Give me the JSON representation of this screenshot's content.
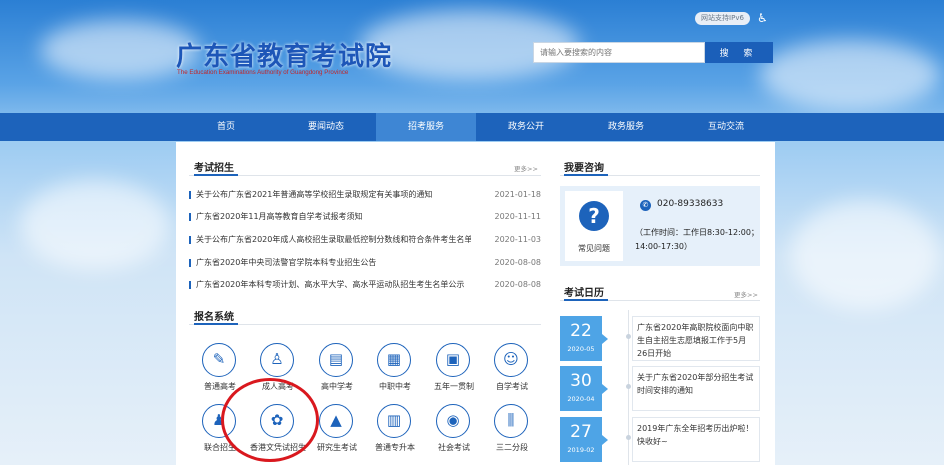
{
  "header": {
    "title": "广东省教育考试院",
    "subtitle": "The Education Examinations Authority of Guangdong Province",
    "ipv6_badge": "网站支持IPv6",
    "accessibility_icon": "accessibility-icon",
    "search": {
      "placeholder": "请输入要搜索的内容",
      "button_label": "搜 索"
    }
  },
  "nav": {
    "items": [
      {
        "label": "首页"
      },
      {
        "label": "要闻动态"
      },
      {
        "label": "招考服务"
      },
      {
        "label": "政务公开"
      },
      {
        "label": "政务服务"
      },
      {
        "label": "互动交流"
      }
    ],
    "active_index": 2
  },
  "exam_recruit": {
    "title": "考试招生",
    "more": "更多>>",
    "news": [
      {
        "text": "关于公布广东省2021年普通高等学校招生录取规定有关事项的通知",
        "date": "2021-01-18"
      },
      {
        "text": "广东省2020年11月高等教育自学考试报考须知",
        "date": "2020-11-11"
      },
      {
        "text": "关于公布广东省2020年成人高校招生录取最低控制分数线和符合条件考生名单的通知",
        "date": "2020-11-03"
      },
      {
        "text": "广东省2020年中央司法警官学院本科专业招生公告",
        "date": "2020-08-08"
      },
      {
        "text": "广东省2020年本科专项计划、高水平大学、高水平运动队招生考生名单公示",
        "date": "2020-08-08"
      }
    ]
  },
  "consult": {
    "title": "我要咨询",
    "faq_label": "常见问题",
    "faq_icon": "question-icon",
    "phone_icon": "phone-icon",
    "phone": "020-89338633",
    "hours": "（工作时间：工作日8:30-12:00；14:00-17:30）"
  },
  "calendar": {
    "title": "考试日历",
    "more": "更多>>",
    "items": [
      {
        "day": "22",
        "ym": "2020-05",
        "text": "广东省2020年高职院校面向中职生自主招生志愿填报工作于5月26日开始"
      },
      {
        "day": "30",
        "ym": "2020-04",
        "text": "关于广东省2020年部分招生考试时间安排的通知"
      },
      {
        "day": "27",
        "ym": "2019-02",
        "text": "2019年广东全年招考历出炉啦！快收好~"
      }
    ]
  },
  "systems": {
    "title": "报名系统",
    "items": [
      {
        "label": "普通高考",
        "icon": "edit-doc-icon",
        "glyph": "✎"
      },
      {
        "label": "成人高考",
        "icon": "person-icon",
        "glyph": "♙"
      },
      {
        "label": "高中学考",
        "icon": "book-icon",
        "glyph": "▤"
      },
      {
        "label": "中职中考",
        "icon": "document-icon",
        "glyph": "▦"
      },
      {
        "label": "五年一贯制",
        "icon": "briefcase-icon",
        "glyph": "▣"
      },
      {
        "label": "自学考试",
        "icon": "student-icon",
        "glyph": "☺"
      },
      {
        "label": "联合招生",
        "icon": "people-icon",
        "glyph": "♟"
      },
      {
        "label": "香港文凭试招生",
        "icon": "bauhinia-icon",
        "glyph": "✿"
      },
      {
        "label": "研究生考试",
        "icon": "graduation-cap-icon",
        "glyph": "▲"
      },
      {
        "label": "普通专升本",
        "icon": "book-open-icon",
        "glyph": "▥"
      },
      {
        "label": "社会考试",
        "icon": "location-icon",
        "glyph": "◉"
      },
      {
        "label": "三二分段",
        "icon": "sliders-icon",
        "glyph": "⫼"
      }
    ]
  },
  "colors": {
    "primary": "#1d63bb",
    "active_nav": "#3e86d4",
    "highlight": "#d9181e",
    "calendar": "#4ea4e6"
  }
}
